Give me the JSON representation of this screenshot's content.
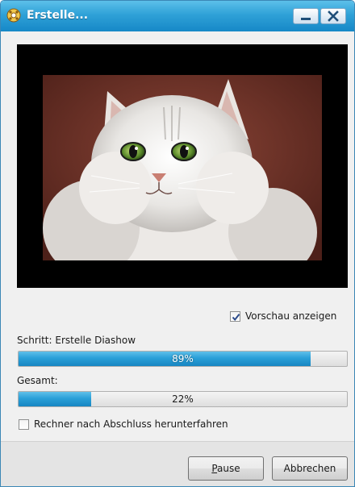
{
  "window": {
    "title": "Erstelle...",
    "titlebar_color": "#2fa1d7"
  },
  "titlebar_buttons": {
    "minimize": "minimize-icon",
    "close": "close-icon"
  },
  "preview": {
    "image": "kitten-photo",
    "show_preview": {
      "label": "Vorschau anzeigen",
      "checked": true
    }
  },
  "step": {
    "label": "Schritt: Erstelle Diashow",
    "percent": 89,
    "percent_text": "89%"
  },
  "total": {
    "label": "Gesamt:",
    "percent": 22,
    "percent_text": "22%"
  },
  "shutdown": {
    "label": "Rechner nach Abschluss herunterfahren",
    "checked": false
  },
  "buttons": {
    "pause": "Pause",
    "pause_mnemonic": "P",
    "cancel": "Abbrechen"
  },
  "colors": {
    "accent": "#2aa0d8",
    "progress_track": "#e8e8e8"
  }
}
